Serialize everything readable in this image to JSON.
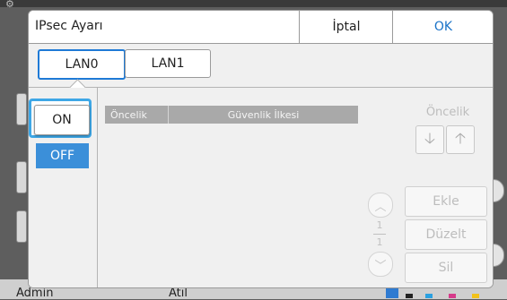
{
  "background": {
    "user_label": "Admin",
    "mode_label": "Atıl"
  },
  "dialog": {
    "title": "IPsec Ayarı",
    "cancel_label": "İptal",
    "ok_label": "OK",
    "tabs": [
      {
        "label": "LAN0",
        "selected": true
      },
      {
        "label": "LAN1",
        "selected": false
      }
    ],
    "toggle": {
      "on_label": "ON",
      "off_label": "OFF",
      "value": "ON"
    },
    "table": {
      "columns": [
        "Öncelik",
        "Güvenlik İlkesi"
      ]
    },
    "priority": {
      "label": "Öncelik",
      "down_icon": "arrow-down-icon",
      "up_icon": "arrow-up-icon"
    },
    "paging": {
      "current": "1",
      "total": "1"
    },
    "actions": {
      "add_label": "Ekle",
      "edit_label": "Düzelt",
      "delete_label": "Sil"
    }
  },
  "colors": {
    "accent": "#1e7ad6",
    "off_button": "#3b8fd9",
    "focus_ring": "#3ea7e6",
    "ok_text": "#1a73c8"
  }
}
